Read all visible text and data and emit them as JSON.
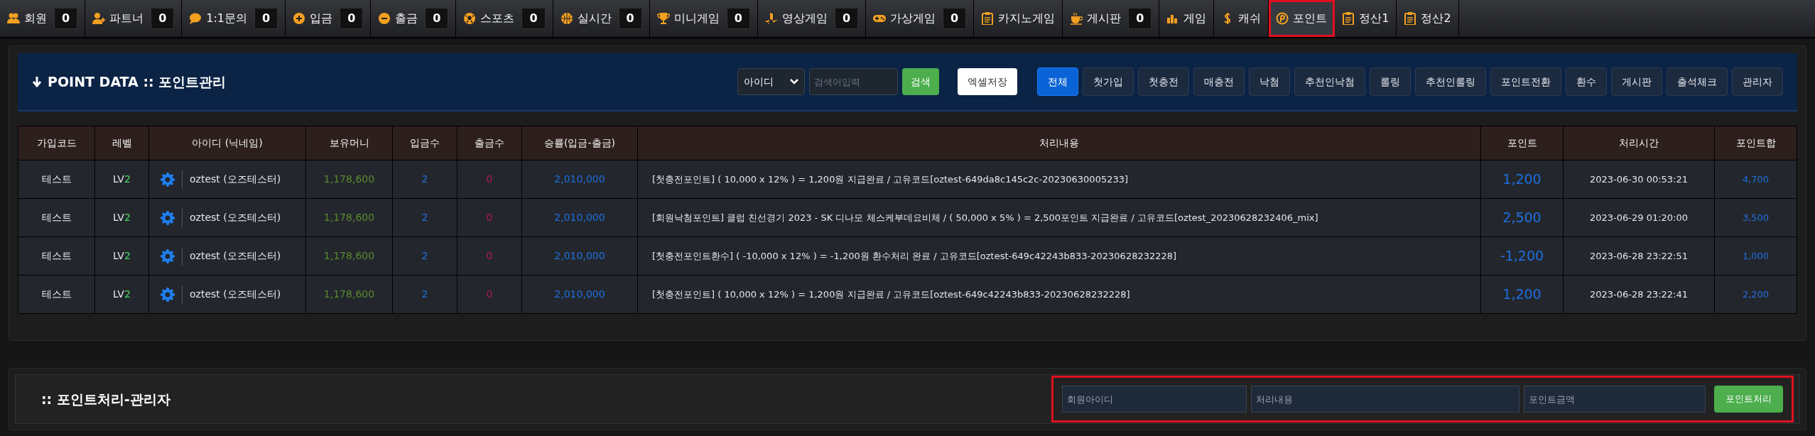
{
  "nav": [
    {
      "label": "회원",
      "count": "0",
      "selected": false,
      "highlighted": false
    },
    {
      "label": "파트너",
      "count": "0",
      "selected": false,
      "highlighted": false
    },
    {
      "label": "1:1문의",
      "count": "0",
      "selected": false,
      "highlighted": false
    },
    {
      "label": "입금",
      "count": "0",
      "selected": false,
      "highlighted": false
    },
    {
      "label": "출금",
      "count": "0",
      "selected": false,
      "highlighted": false
    },
    {
      "label": "스포츠",
      "count": "0",
      "selected": false,
      "highlighted": false
    },
    {
      "label": "실시간",
      "count": "0",
      "selected": false,
      "highlighted": false
    },
    {
      "label": "미니게임",
      "count": "0",
      "selected": false,
      "highlighted": false
    },
    {
      "label": "영상게임",
      "count": "0",
      "selected": false,
      "highlighted": false
    },
    {
      "label": "가상게임",
      "count": "0",
      "selected": false,
      "highlighted": false
    },
    {
      "label": "카지노게임",
      "selected": false,
      "highlighted": false
    },
    {
      "label": "게시판",
      "count": "0",
      "selected": false,
      "highlighted": false
    },
    {
      "label": "게임",
      "selected": false,
      "highlighted": false
    },
    {
      "label": "캐쉬",
      "selected": false,
      "highlighted": false
    },
    {
      "label": "포인트",
      "selected": true,
      "highlighted": true
    },
    {
      "label": "정산1",
      "selected": false,
      "highlighted": false
    },
    {
      "label": "정산2",
      "selected": false,
      "highlighted": false
    }
  ],
  "header": {
    "title": "POINT DATA :: 포인트관리",
    "search_select": "아이디",
    "search_placeholder": "검색어입력",
    "search_button": "검색",
    "excel_button": "엑셀저장",
    "filters": [
      {
        "label": "전체",
        "selected": true
      },
      {
        "label": "첫가입",
        "selected": false
      },
      {
        "label": "첫충전",
        "selected": false
      },
      {
        "label": "매충전",
        "selected": false
      },
      {
        "label": "낙첨",
        "selected": false
      },
      {
        "label": "추천인낙첨",
        "selected": false
      },
      {
        "label": "롤링",
        "selected": false
      },
      {
        "label": "추천인롤링",
        "selected": false
      },
      {
        "label": "포인트전환",
        "selected": false
      },
      {
        "label": "환수",
        "selected": false
      },
      {
        "label": "게시판",
        "selected": false
      },
      {
        "label": "출석체크",
        "selected": false
      },
      {
        "label": "관리자",
        "selected": false
      }
    ]
  },
  "table": {
    "columns": [
      "가입코드",
      "레벨",
      "아이디 (닉네임)",
      "보유머니",
      "입금수",
      "출금수",
      "승률(입금-출금)",
      "처리내용",
      "포인트",
      "처리시간",
      "포인트합"
    ],
    "rows": [
      {
        "code": "테스트",
        "lv_prefix": "LV",
        "lv": "2",
        "user": "oztest (오즈테스터)",
        "money": "1,178,600",
        "deposits": "2",
        "withdrawals": "0",
        "net": "2,010,000",
        "description": "[첫충전포인트] ( 10,000 x 12% ) = 1,200원 지급완료 / 고유코드[oztest-649da8c145c2c-20230630005233]",
        "points": "1,200",
        "time": "2023-06-30 00:53:21",
        "total": "4,700"
      },
      {
        "code": "테스트",
        "lv_prefix": "LV",
        "lv": "2",
        "user": "oztest (오즈테스터)",
        "money": "1,178,600",
        "deposits": "2",
        "withdrawals": "0",
        "net": "2,010,000",
        "description": "[회원낙첨포인트] 클럽 친선경기 2023 - SK 디나모 체스케부데요비체 / ( 50,000 x 5% ) = 2,500포인트 지급완료 / 고유코드[oztest_20230628232406_mix]",
        "points": "2,500",
        "time": "2023-06-29 01:20:00",
        "total": "3,500"
      },
      {
        "code": "테스트",
        "lv_prefix": "LV",
        "lv": "2",
        "user": "oztest (오즈테스터)",
        "money": "1,178,600",
        "deposits": "2",
        "withdrawals": "0",
        "net": "2,010,000",
        "description": "[첫충전포인트환수] ( -10,000 x 12% ) = -1,200원 환수처리 완료 / 고유코드[oztest-649c42243b833-20230628232228]",
        "points": "-1,200",
        "time": "2023-06-28 23:22:51",
        "total": "1,000"
      },
      {
        "code": "테스트",
        "lv_prefix": "LV",
        "lv": "2",
        "user": "oztest (오즈테스터)",
        "money": "1,178,600",
        "deposits": "2",
        "withdrawals": "0",
        "net": "2,010,000",
        "description": "[첫충전포인트] ( 10,000 x 12% ) = 1,200원 지급완료 / 고유코드[oztest-649c42243b833-20230628232228]",
        "points": "1,200",
        "time": "2023-06-28 23:22:41",
        "total": "2,200"
      }
    ]
  },
  "admin": {
    "title": ":: 포인트처리-관리자",
    "fields": [
      {
        "placeholder": "회원아이디"
      },
      {
        "placeholder": "처리내용"
      },
      {
        "placeholder": "포인트금액"
      }
    ],
    "button": "포인트처리",
    "highlighted": true
  }
}
